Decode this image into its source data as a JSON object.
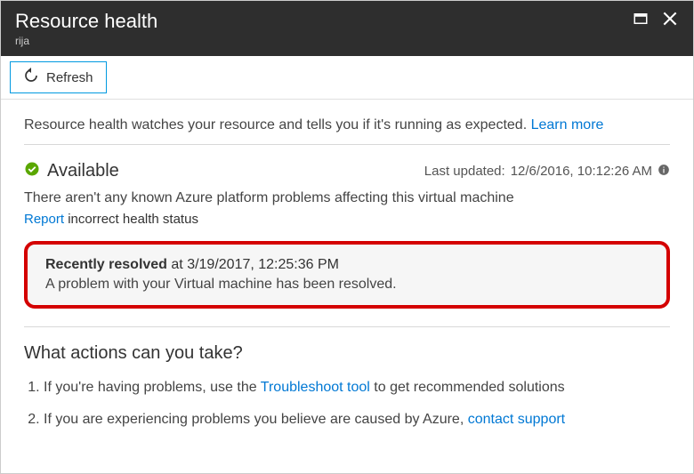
{
  "header": {
    "title": "Resource health",
    "subtitle": "rija"
  },
  "toolbar": {
    "refresh_label": "Refresh"
  },
  "intro": {
    "text": "Resource health watches your resource and tells you if it's running as expected. ",
    "learn_more": "Learn more"
  },
  "status": {
    "label": "Available",
    "updated_prefix": "Last updated: ",
    "updated_value": "12/6/2016, 10:12:26 AM",
    "detail": "There aren't any known Azure platform problems affecting this virtual machine",
    "report_link": "Report",
    "report_suffix": " incorrect health status"
  },
  "resolved": {
    "prefix": "Recently resolved",
    "at": " at 3/19/2017, 12:25:36 PM",
    "description": "A problem with your Virtual machine has been resolved."
  },
  "actions": {
    "heading": "What actions can you take?",
    "items": [
      {
        "pre": "If you're having problems, use the ",
        "link": "Troubleshoot tool",
        "post": " to get recommended solutions"
      },
      {
        "pre": "If you are experiencing problems you believe are caused by Azure, ",
        "link": "contact support",
        "post": ""
      }
    ]
  }
}
